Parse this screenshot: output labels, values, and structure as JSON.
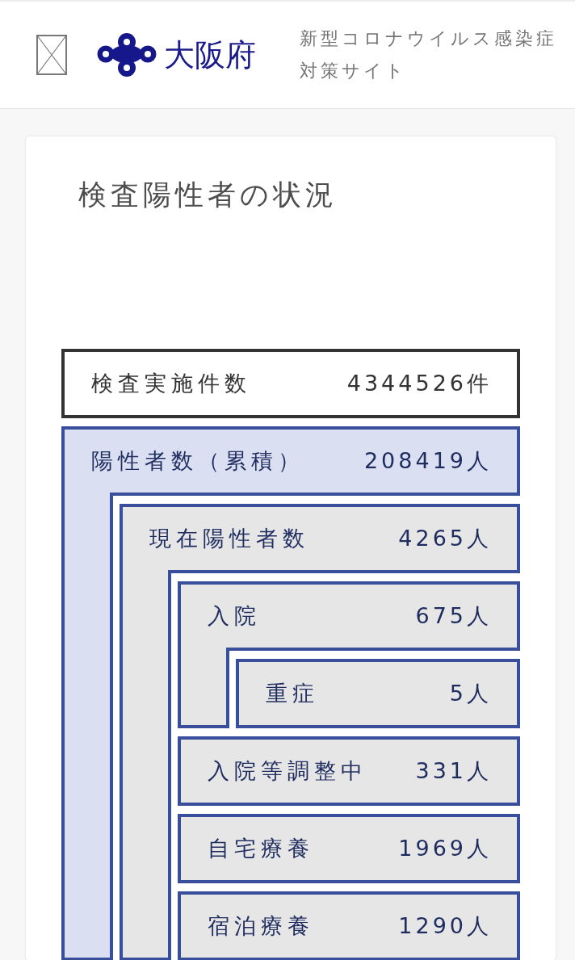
{
  "header": {
    "logo_text": "大阪府",
    "site_title": "新型コロナウイルス感染症対策サイト"
  },
  "card": {
    "title": "検査陽性者の状況",
    "boxes": [
      {
        "kind": "plain",
        "label": "検査実施件数",
        "value": "4344526件"
      },
      {
        "kind": "accent",
        "label": "陽性者数（累積）",
        "value": "208419人",
        "children": [
          {
            "kind": "muted",
            "label": "現在陽性者数",
            "value": "4265人",
            "children": [
              {
                "kind": "muted",
                "label": "入院",
                "value": "675人",
                "children": [
                  {
                    "kind": "muted",
                    "label": "重症",
                    "value": "5人"
                  }
                ]
              },
              {
                "kind": "muted",
                "label": "入院等調整中",
                "value": "331人"
              },
              {
                "kind": "muted",
                "label": "自宅療養",
                "value": "1969人"
              },
              {
                "kind": "muted",
                "label": "宿泊療養",
                "value": "1290人"
              }
            ]
          }
        ]
      }
    ]
  }
}
